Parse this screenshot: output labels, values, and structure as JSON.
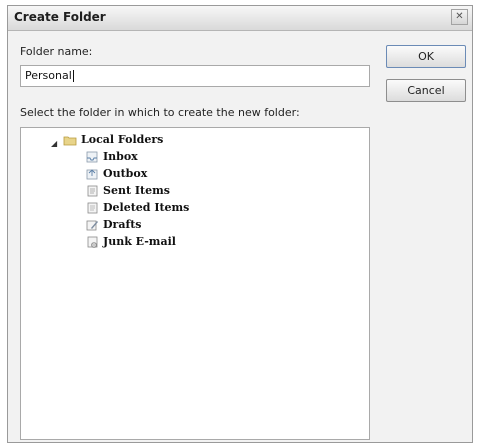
{
  "window": {
    "title": "Create Folder"
  },
  "form": {
    "folder_name_label": "Folder name:",
    "folder_name_value": "Personal",
    "select_label": "Select the folder in which to create the new folder:"
  },
  "buttons": {
    "ok": "OK",
    "cancel": "Cancel"
  },
  "tree": {
    "root": {
      "label": "Local Folders",
      "icon": "folder-icon",
      "expanded": true
    },
    "children": [
      {
        "label": "Inbox",
        "icon": "inbox-icon"
      },
      {
        "label": "Outbox",
        "icon": "outbox-icon"
      },
      {
        "label": "Sent Items",
        "icon": "sent-items-icon"
      },
      {
        "label": "Deleted Items",
        "icon": "deleted-items-icon"
      },
      {
        "label": "Drafts",
        "icon": "drafts-icon"
      },
      {
        "label": "Junk E-mail",
        "icon": "junk-email-icon"
      }
    ]
  }
}
